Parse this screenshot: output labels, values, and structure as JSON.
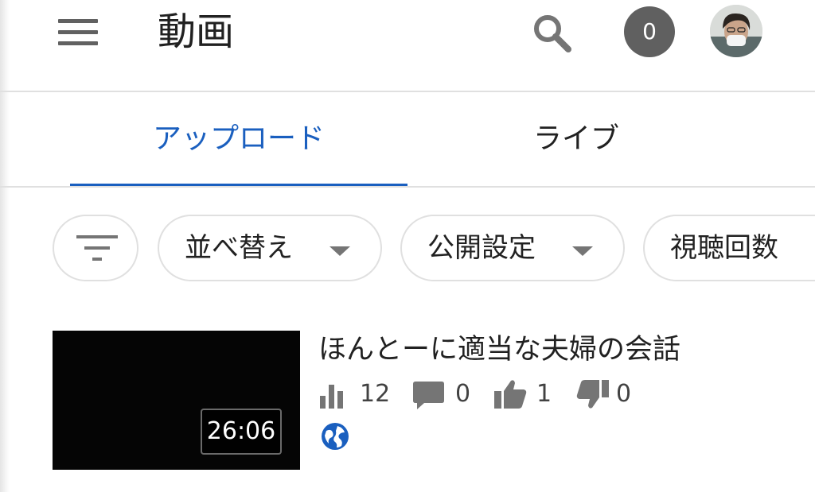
{
  "header": {
    "title": "動画",
    "notification_count": "0",
    "icons": {
      "menu": "hamburger-menu-icon",
      "search": "search-icon",
      "avatar": "user-avatar"
    }
  },
  "tabs": [
    {
      "label": "アップロード",
      "selected": true
    },
    {
      "label": "ライブ",
      "selected": false
    }
  ],
  "filters": {
    "filter_icon": "filter-list-icon",
    "chips": [
      {
        "label": "並べ替え",
        "has_dropdown": true
      },
      {
        "label": "公開設定",
        "has_dropdown": true
      },
      {
        "label": "視聴回数",
        "has_dropdown": false
      }
    ]
  },
  "videos": [
    {
      "title": "ほんとーに適当な夫婦の会話",
      "duration": "26:06",
      "views": "12",
      "comments": "0",
      "likes": "1",
      "dislikes": "0",
      "visibility_icon": "public-globe-icon"
    }
  ],
  "colors": {
    "accent": "#1a5fbf",
    "badge_bg": "#606060",
    "divider": "#e0e0e0",
    "icon_gray": "#757575"
  }
}
